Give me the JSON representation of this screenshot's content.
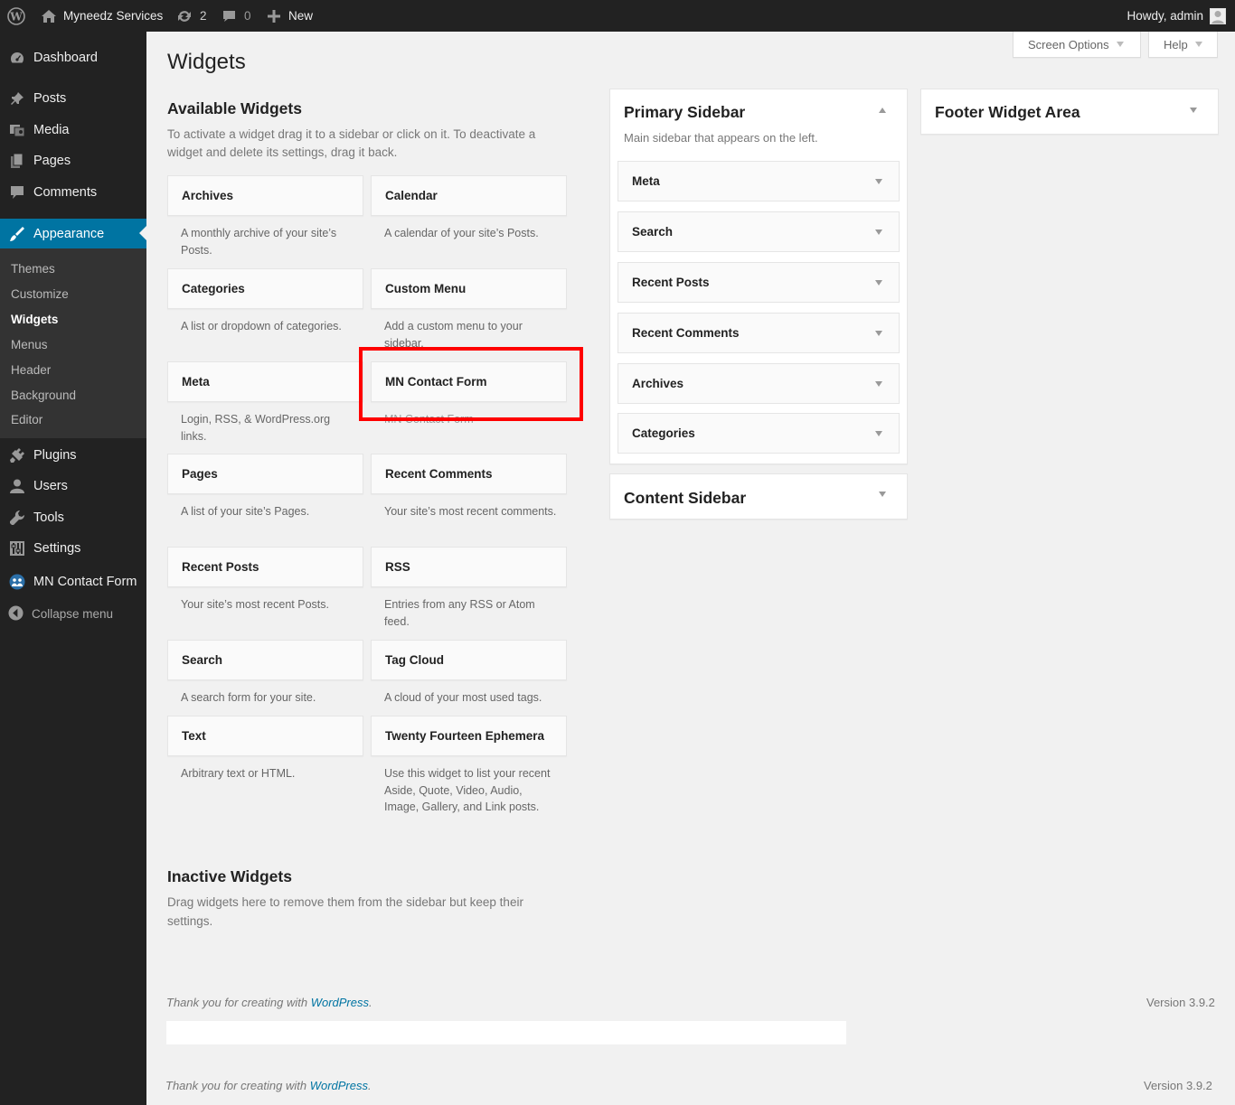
{
  "admin_bar": {
    "site_name": "Myneedz Services",
    "updates_count": "2",
    "comments_count": "0",
    "new_label": "New",
    "howdy": "Howdy, admin"
  },
  "menu": {
    "dashboard": "Dashboard",
    "posts": "Posts",
    "media": "Media",
    "pages": "Pages",
    "comments": "Comments",
    "appearance": "Appearance",
    "plugins": "Plugins",
    "users": "Users",
    "tools": "Tools",
    "settings": "Settings",
    "mn_contact_form": "MN Contact Form",
    "collapse": "Collapse menu"
  },
  "appearance_submenu": [
    "Themes",
    "Customize",
    "Widgets",
    "Menus",
    "Header",
    "Background",
    "Editor"
  ],
  "screen_options": "Screen Options",
  "help": "Help",
  "page_title": "Widgets",
  "available": {
    "heading": "Available Widgets",
    "desc_line1": "To activate a widget drag it to a sidebar or click on it. To deactivate a",
    "desc_line2": "widget and delete its settings, drag it back.",
    "widgets": [
      {
        "title": "Archives",
        "desc": "A monthly archive of your site’s Posts."
      },
      {
        "title": "Calendar",
        "desc": "A calendar of your site’s Posts."
      },
      {
        "title": "Categories",
        "desc": "A list or dropdown of categories."
      },
      {
        "title": "Custom Menu",
        "desc": "Add a custom menu to your sidebar."
      },
      {
        "title": "Meta",
        "desc": "Login, RSS, & WordPress.org links."
      },
      {
        "title": "MN Contact Form",
        "desc": "MN Contact Form"
      },
      {
        "title": "Pages",
        "desc": "A list of your site’s Pages."
      },
      {
        "title": "Recent Comments",
        "desc": "Your site’s most recent comments."
      },
      {
        "title": "Recent Posts",
        "desc": "Your site’s most recent Posts."
      },
      {
        "title": "RSS",
        "desc": "Entries from any RSS or Atom feed."
      },
      {
        "title": "Search",
        "desc": "A search form for your site."
      },
      {
        "title": "Tag Cloud",
        "desc": "A cloud of your most used tags."
      },
      {
        "title": "Text",
        "desc": "Arbitrary text or HTML."
      },
      {
        "title": "Twenty Fourteen Ephemera",
        "desc": "Use this widget to list your recent Aside, Quote, Video, Audio, Image, Gallery, and Link posts."
      }
    ]
  },
  "inactive": {
    "heading": "Inactive Widgets",
    "desc_line1": "Drag widgets here to remove them from the sidebar but keep their",
    "desc_line2": "settings."
  },
  "primary_sidebar": {
    "title": "Primary Sidebar",
    "desc": "Main sidebar that appears on the left.",
    "widgets": [
      "Meta",
      "Search",
      "Recent Posts",
      "Recent Comments",
      "Archives",
      "Categories"
    ]
  },
  "content_sidebar": {
    "title": "Content Sidebar"
  },
  "footer_widget_area": {
    "title": "Footer Widget Area"
  },
  "footer": {
    "thanks_prefix": "Thank you for creating with ",
    "wordpress_link": "WordPress",
    "thanks_suffix": ".",
    "version": "Version 3.9.2"
  },
  "colors": {
    "accent": "#0074a2",
    "highlight": "#ff0000",
    "bar": "#222222"
  }
}
